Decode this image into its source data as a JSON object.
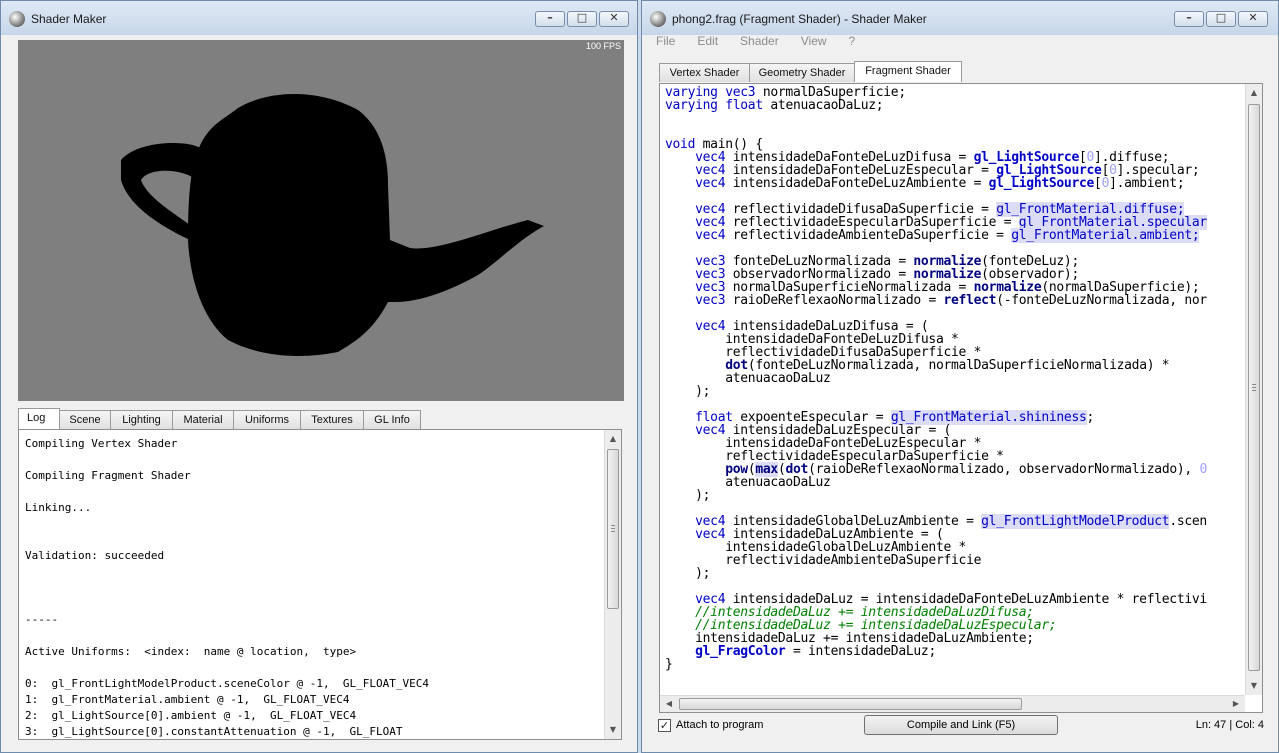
{
  "left_window": {
    "title": "Shader Maker",
    "fps": "100 FPS",
    "tabs": [
      "Log",
      "Scene",
      "Lighting",
      "Material",
      "Uniforms",
      "Textures",
      "GL Info"
    ],
    "log_lines": [
      "Compiling Vertex Shader",
      "",
      "Compiling Fragment Shader",
      "",
      "Linking...",
      "",
      "",
      "Validation: succeeded",
      "",
      "",
      "",
      "-----",
      "",
      "Active Uniforms:  <index:  name @ location,  type>",
      "",
      "0:  gl_FrontLightModelProduct.sceneColor @ -1,  GL_FLOAT_VEC4",
      "1:  gl_FrontMaterial.ambient @ -1,  GL_FLOAT_VEC4",
      "2:  gl_LightSource[0].ambient @ -1,  GL_FLOAT_VEC4",
      "3:  gl_LightSource[0].constantAttenuation @ -1,  GL_FLOAT"
    ]
  },
  "right_window": {
    "title": "phong2.frag (Fragment Shader)  - Shader Maker",
    "menu": [
      "File",
      "Edit",
      "Shader",
      "View",
      "?"
    ],
    "tabs": [
      "Vertex Shader",
      "Geometry Shader",
      "Fragment Shader"
    ],
    "active_tab": "Fragment Shader",
    "attach_label": "Attach to program",
    "attach_checked": true,
    "compile_button": "Compile and Link (F5)",
    "status": "Ln: 47 | Col: 4"
  },
  "colors": {
    "keyword": "#0000c8",
    "builtin_function": "#000080",
    "comment": "#008000",
    "number": "#a0a0ff",
    "highlight": "#dcdcf6",
    "viewport_bg": "#7f7f7f"
  },
  "icons": [
    "app-icon",
    "minimize-icon",
    "maximize-icon",
    "close-icon",
    "scroll-up-arrow-icon",
    "scroll-down-arrow-icon",
    "scroll-left-arrow-icon",
    "scroll-right-arrow-icon",
    "checkmark-icon"
  ],
  "code_lines": [
    [
      {
        "t": "varying ",
        "c": "kw"
      },
      {
        "t": "vec3",
        "c": "kw"
      },
      {
        "t": " normalDaSuperficie;"
      }
    ],
    [
      {
        "t": "varying ",
        "c": "kw"
      },
      {
        "t": "float",
        "c": "kw"
      },
      {
        "t": " atenuacaoDaLuz;"
      }
    ],
    [],
    [],
    [
      {
        "t": "void",
        "c": "kw"
      },
      {
        "t": " main() {"
      }
    ],
    [
      {
        "t": "    "
      },
      {
        "t": "vec4",
        "c": "kw"
      },
      {
        "t": " intensidadeDaFonteDeLuzDifusa = "
      },
      {
        "t": "gl_LightSource",
        "c": "gl"
      },
      {
        "t": "["
      },
      {
        "t": "0",
        "c": "num"
      },
      {
        "t": "].diffuse;"
      }
    ],
    [
      {
        "t": "    "
      },
      {
        "t": "vec4",
        "c": "kw"
      },
      {
        "t": " intensidadeDaFonteDeLuzEspecular = "
      },
      {
        "t": "gl_LightSource",
        "c": "gl"
      },
      {
        "t": "["
      },
      {
        "t": "0",
        "c": "num"
      },
      {
        "t": "].specular;"
      }
    ],
    [
      {
        "t": "    "
      },
      {
        "t": "vec4",
        "c": "kw"
      },
      {
        "t": " intensidadeDaFonteDeLuzAmbiente = "
      },
      {
        "t": "gl_LightSource",
        "c": "gl"
      },
      {
        "t": "["
      },
      {
        "t": "0",
        "c": "num"
      },
      {
        "t": "].ambient;"
      }
    ],
    [],
    [
      {
        "t": "    "
      },
      {
        "t": "vec4",
        "c": "kw"
      },
      {
        "t": " reflectividadeDifusaDaSuperficie = "
      },
      {
        "t": "gl_FrontMaterial.diffuse;",
        "c": "glhi"
      }
    ],
    [
      {
        "t": "    "
      },
      {
        "t": "vec4",
        "c": "kw"
      },
      {
        "t": " reflectividadeEspecularDaSuperficie = "
      },
      {
        "t": "gl_FrontMaterial.specular",
        "c": "glhi"
      }
    ],
    [
      {
        "t": "    "
      },
      {
        "t": "vec4",
        "c": "kw"
      },
      {
        "t": " reflectividadeAmbienteDaSuperficie = "
      },
      {
        "t": "gl_FrontMaterial.ambient;",
        "c": "glhi"
      }
    ],
    [],
    [
      {
        "t": "    "
      },
      {
        "t": "vec3",
        "c": "kw"
      },
      {
        "t": " fonteDeLuzNormalizada = "
      },
      {
        "t": "normalize",
        "c": "fn"
      },
      {
        "t": "(fonteDeLuz);"
      }
    ],
    [
      {
        "t": "    "
      },
      {
        "t": "vec3",
        "c": "kw"
      },
      {
        "t": " observadorNormalizado = "
      },
      {
        "t": "normalize",
        "c": "fn"
      },
      {
        "t": "(observador);"
      }
    ],
    [
      {
        "t": "    "
      },
      {
        "t": "vec3",
        "c": "kw"
      },
      {
        "t": " normalDaSuperficieNormalizada = "
      },
      {
        "t": "normalize",
        "c": "fn"
      },
      {
        "t": "(normalDaSuperficie);"
      }
    ],
    [
      {
        "t": "    "
      },
      {
        "t": "vec3",
        "c": "kw"
      },
      {
        "t": " raioDeReflexaoNormalizado = "
      },
      {
        "t": "reflect",
        "c": "fn"
      },
      {
        "t": "(-fonteDeLuzNormalizada, nor"
      }
    ],
    [],
    [
      {
        "t": "    "
      },
      {
        "t": "vec4",
        "c": "kw"
      },
      {
        "t": " intensidadeDaLuzDifusa = ("
      }
    ],
    [
      {
        "t": "        intensidadeDaFonteDeLuzDifusa *"
      }
    ],
    [
      {
        "t": "        reflectividadeDifusaDaSuperficie *"
      }
    ],
    [
      {
        "t": "        "
      },
      {
        "t": "dot",
        "c": "fn"
      },
      {
        "t": "(fonteDeLuzNormalizada, normalDaSuperficieNormalizada) *"
      }
    ],
    [
      {
        "t": "        atenuacaoDaLuz"
      }
    ],
    [
      {
        "t": "    );"
      }
    ],
    [],
    [
      {
        "t": "    "
      },
      {
        "t": "float",
        "c": "kw"
      },
      {
        "t": " expoenteEspecular = "
      },
      {
        "t": "gl_FrontMaterial.shininess",
        "c": "glhi"
      },
      {
        "t": ";"
      }
    ],
    [
      {
        "t": "    "
      },
      {
        "t": "vec4",
        "c": "kw"
      },
      {
        "t": " intensidadeDaLuzEspecular = ("
      }
    ],
    [
      {
        "t": "        intensidadeDaFonteDeLuzEspecular *"
      }
    ],
    [
      {
        "t": "        reflectividadeEspecularDaSuperficie *"
      }
    ],
    [
      {
        "t": "        "
      },
      {
        "t": "pow",
        "c": "fn"
      },
      {
        "t": "("
      },
      {
        "t": "max",
        "c": "fn hl"
      },
      {
        "t": "("
      },
      {
        "t": "dot",
        "c": "fn"
      },
      {
        "t": "(raioDeReflexaoNormalizado, observadorNormalizado), "
      },
      {
        "t": "0",
        "c": "num"
      }
    ],
    [
      {
        "t": "        atenuacaoDaLuz"
      }
    ],
    [
      {
        "t": "    );"
      }
    ],
    [],
    [
      {
        "t": "    "
      },
      {
        "t": "vec4",
        "c": "kw"
      },
      {
        "t": " intensidadeGlobalDeLuzAmbiente = "
      },
      {
        "t": "gl_FrontLightModelProduct",
        "c": "glhi"
      },
      {
        "t": ".scen"
      }
    ],
    [
      {
        "t": "    "
      },
      {
        "t": "vec4",
        "c": "kw"
      },
      {
        "t": " intensidadeDaLuzAmbiente = ("
      }
    ],
    [
      {
        "t": "        intensidadeGlobalDeLuzAmbiente *"
      }
    ],
    [
      {
        "t": "        reflectividadeAmbienteDaSuperficie"
      }
    ],
    [
      {
        "t": "    );"
      }
    ],
    [],
    [
      {
        "t": "    "
      },
      {
        "t": "vec4",
        "c": "kw"
      },
      {
        "t": " intensidadeDaLuz = intensidadeDaFonteDeLuzAmbiente * reflectivi"
      }
    ],
    [
      {
        "t": "    "
      },
      {
        "t": "//intensidadeDaLuz += intensidadeDaLuzDifusa;",
        "c": "cm"
      }
    ],
    [
      {
        "t": "    "
      },
      {
        "t": "//intensidadeDaLuz += intensidadeDaLuzEspecular;",
        "c": "cm"
      }
    ],
    [
      {
        "t": "    intensidadeDaLuz += intensidadeDaLuzAmbiente;"
      }
    ],
    [
      {
        "t": "    "
      },
      {
        "t": "gl_FragColor",
        "c": "gl"
      },
      {
        "t": " = intensidadeDaLuz;"
      }
    ],
    [
      {
        "t": "}"
      }
    ]
  ]
}
